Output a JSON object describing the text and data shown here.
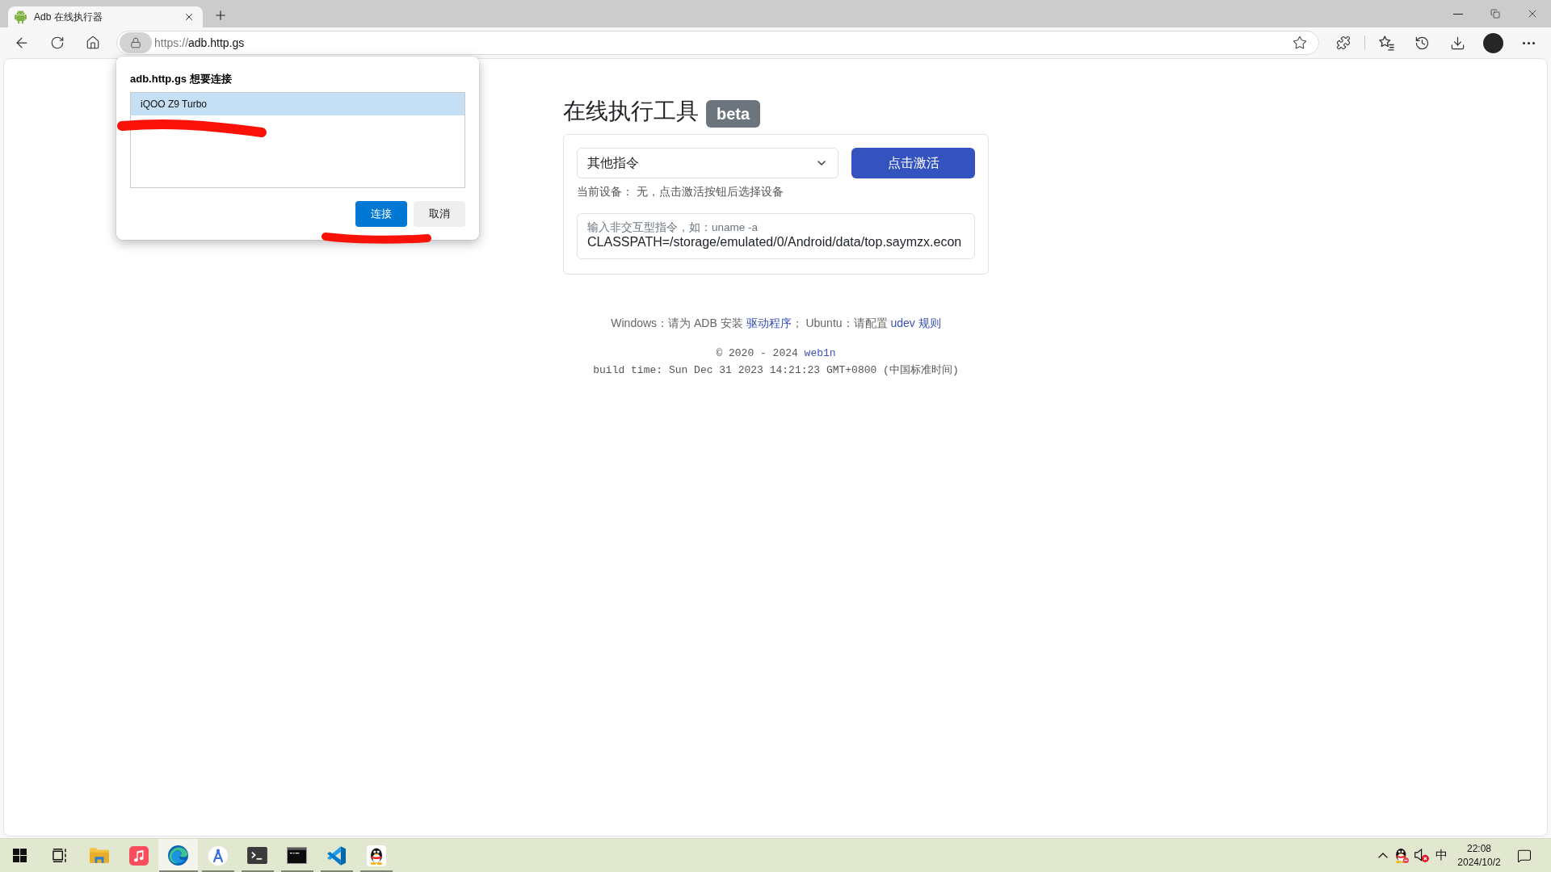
{
  "browser": {
    "tabs": [
      {
        "title": "Adb 在线执行器",
        "selected": true
      }
    ],
    "address": {
      "scheme": "https://",
      "host": "adb.http.gs"
    }
  },
  "permission_dialog": {
    "title": "adb.http.gs 想要连接",
    "devices": [
      {
        "name": "iQOO Z9 Turbo",
        "selected": true
      }
    ],
    "buttons": [
      {
        "label": "连接",
        "kind": "primary"
      },
      {
        "label": "取消",
        "kind": "secondary"
      }
    ]
  },
  "page": {
    "title": "在线执行工具",
    "badge": "beta",
    "command_select": {
      "value": "其他指令"
    },
    "activate_button": {
      "label": "点击激活"
    },
    "device_status": "当前设备： 无，点击激活按钮后选择设备",
    "command_input": {
      "label": "输入非交互型指令，如：uname -a",
      "value": "CLASSPATH=/storage/emulated/0/Android/data/top.saymzx.econ"
    },
    "help": [
      {
        "kind": "text",
        "text": "Windows：请为 ADB 安装 "
      },
      {
        "kind": "link",
        "text": "驱动程序"
      },
      {
        "kind": "text",
        "text": "； Ubuntu：请配置 "
      },
      {
        "kind": "link",
        "text": "udev 规则"
      }
    ],
    "copyright": [
      {
        "kind": "text",
        "text": "© 2020 - 2024 "
      },
      {
        "kind": "link",
        "text": "web1n"
      }
    ],
    "build_time": "build time: Sun Dec 31 2023 14:21:23 GMT+0800 (中国标准时间)"
  },
  "taskbar": {
    "apps": [
      {
        "kind": "start",
        "running": false,
        "selected": false
      },
      {
        "kind": "task-view",
        "running": false,
        "selected": false
      },
      {
        "kind": "file-explorer",
        "running": false,
        "selected": false
      },
      {
        "kind": "music",
        "running": false,
        "selected": false
      },
      {
        "kind": "browser",
        "running": true,
        "selected": true
      },
      {
        "kind": "compass",
        "running": true,
        "selected": false
      },
      {
        "kind": "terminal",
        "running": true,
        "selected": false
      },
      {
        "kind": "console",
        "running": true,
        "selected": false
      },
      {
        "kind": "code-editor",
        "running": true,
        "selected": false
      },
      {
        "kind": "penguin-chat",
        "running": true,
        "selected": false
      }
    ],
    "tray": {
      "volume_muted": true,
      "ime": "中",
      "time": "22:08",
      "date": "2024/10/2"
    }
  }
}
